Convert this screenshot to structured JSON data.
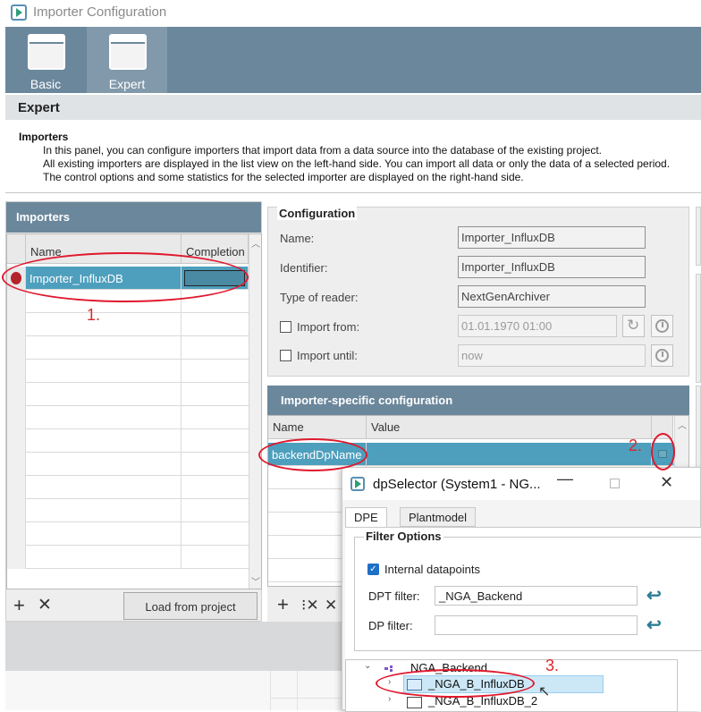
{
  "window": {
    "title": "Importer Configuration"
  },
  "ribbon": {
    "buttons": [
      {
        "label": "Basic"
      },
      {
        "label": "Expert"
      }
    ]
  },
  "section": {
    "title": "Expert"
  },
  "intro": {
    "heading": "Importers",
    "lines": [
      "In this panel, you can configure importers that import data from a data source into the database of the existing project.",
      "All existing importers are displayed in the list view on the left-hand side. You can import all data or only the data of a selected period.",
      "The control options and some statistics for the selected importer are displayed on the right-hand side."
    ]
  },
  "importers": {
    "title": "Importers",
    "columns": [
      "Name",
      "Completion"
    ],
    "rows": [
      {
        "name": "Importer_InfluxDB",
        "completion": ""
      }
    ],
    "load_button": "Load from project"
  },
  "configuration": {
    "title": "Configuration",
    "fields": [
      {
        "label": "Name:",
        "value": "Importer_InfluxDB"
      },
      {
        "label": "Identifier:",
        "value": "Importer_InfluxDB"
      },
      {
        "label": "Type of reader:",
        "value": "NextGenArchiver"
      }
    ],
    "import_from": {
      "label": "Import from:",
      "value": "01.01.1970 01:00",
      "checked": false
    },
    "import_until": {
      "label": "Import until:",
      "value": "now",
      "checked": false
    }
  },
  "specific": {
    "title": "Importer-specific configuration",
    "columns": [
      "Name",
      "Value"
    ],
    "rows": [
      {
        "name": "backendDpName",
        "value": ""
      }
    ]
  },
  "dialog": {
    "title": "dpSelector (System1 - NG...",
    "tabs": [
      "DPE",
      "Plantmodel"
    ],
    "filter_title": "Filter Options",
    "internal_label": "Internal datapoints",
    "internal_checked": true,
    "dpt_label": "DPT filter:",
    "dpt_value": "_NGA_Backend",
    "dp_label": "DP filter:",
    "dp_value": "",
    "tree": [
      {
        "label": "NGA_Backend"
      },
      {
        "label": "_NGA_B_InfluxDB"
      },
      {
        "label": "_NGA_B_InfluxDB_2"
      }
    ]
  },
  "annotations": [
    "1.",
    "2.",
    "3."
  ],
  "colors": {
    "header_bg": "#6b879c",
    "selection": "#4d9fbd",
    "annotation": "#e0182d"
  }
}
